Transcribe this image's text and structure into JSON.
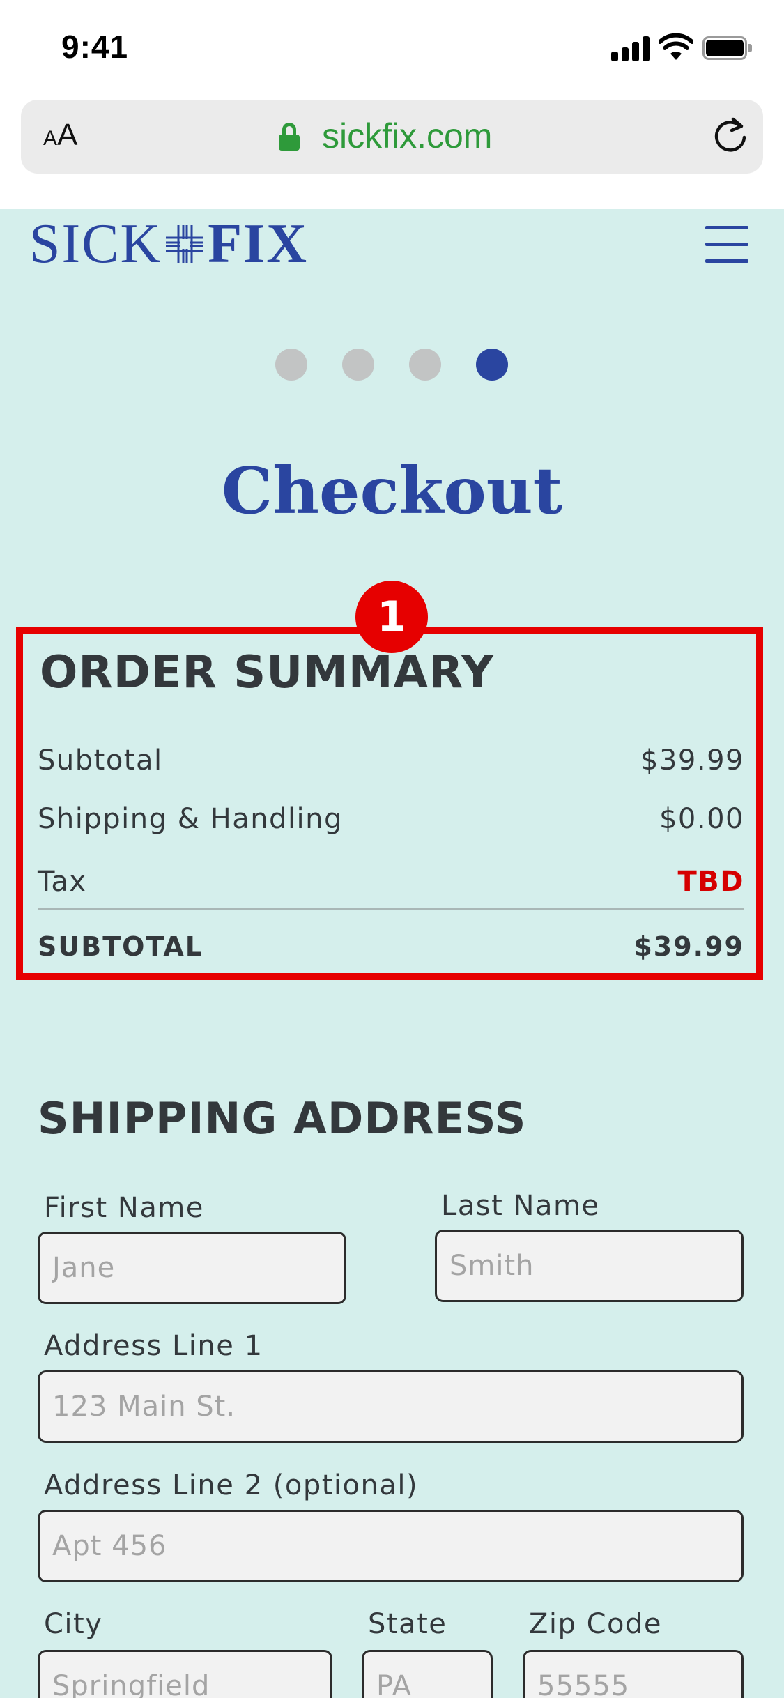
{
  "status_bar": {
    "time": "9:41"
  },
  "browser": {
    "aa_small": "A",
    "aa_big": "A",
    "url": "sickfix.com"
  },
  "brand": {
    "logo_left": "SICK",
    "logo_right": "FIX",
    "primary_color": "#2a45a0"
  },
  "progress": {
    "total_steps": 4,
    "current_step": 4
  },
  "page": {
    "title": "Checkout",
    "background": "#d5efec"
  },
  "annotation": {
    "badge": "1",
    "color": "#e60000"
  },
  "order_summary": {
    "heading": "ORDER SUMMARY",
    "rows": [
      {
        "label": "Subtotal",
        "value": "$39.99"
      },
      {
        "label": "Shipping & Handling",
        "value": "$0.00"
      },
      {
        "label": "Tax",
        "value": "TBD"
      }
    ],
    "total": {
      "label": "SUBTOTAL",
      "value": "$39.99"
    }
  },
  "shipping": {
    "heading": "SHIPPING ADDRESS",
    "first_name": {
      "label": "First Name",
      "placeholder": "Jane"
    },
    "last_name": {
      "label": "Last Name",
      "placeholder": "Smith"
    },
    "address1": {
      "label": "Address Line 1",
      "placeholder": "123 Main St."
    },
    "address2": {
      "label": "Address Line 2 (optional)",
      "placeholder": "Apt 456"
    },
    "city": {
      "label": "City",
      "placeholder": "Springfield"
    },
    "state": {
      "label": "State",
      "placeholder": "PA"
    },
    "zip": {
      "label": "Zip Code",
      "placeholder": "55555"
    }
  }
}
